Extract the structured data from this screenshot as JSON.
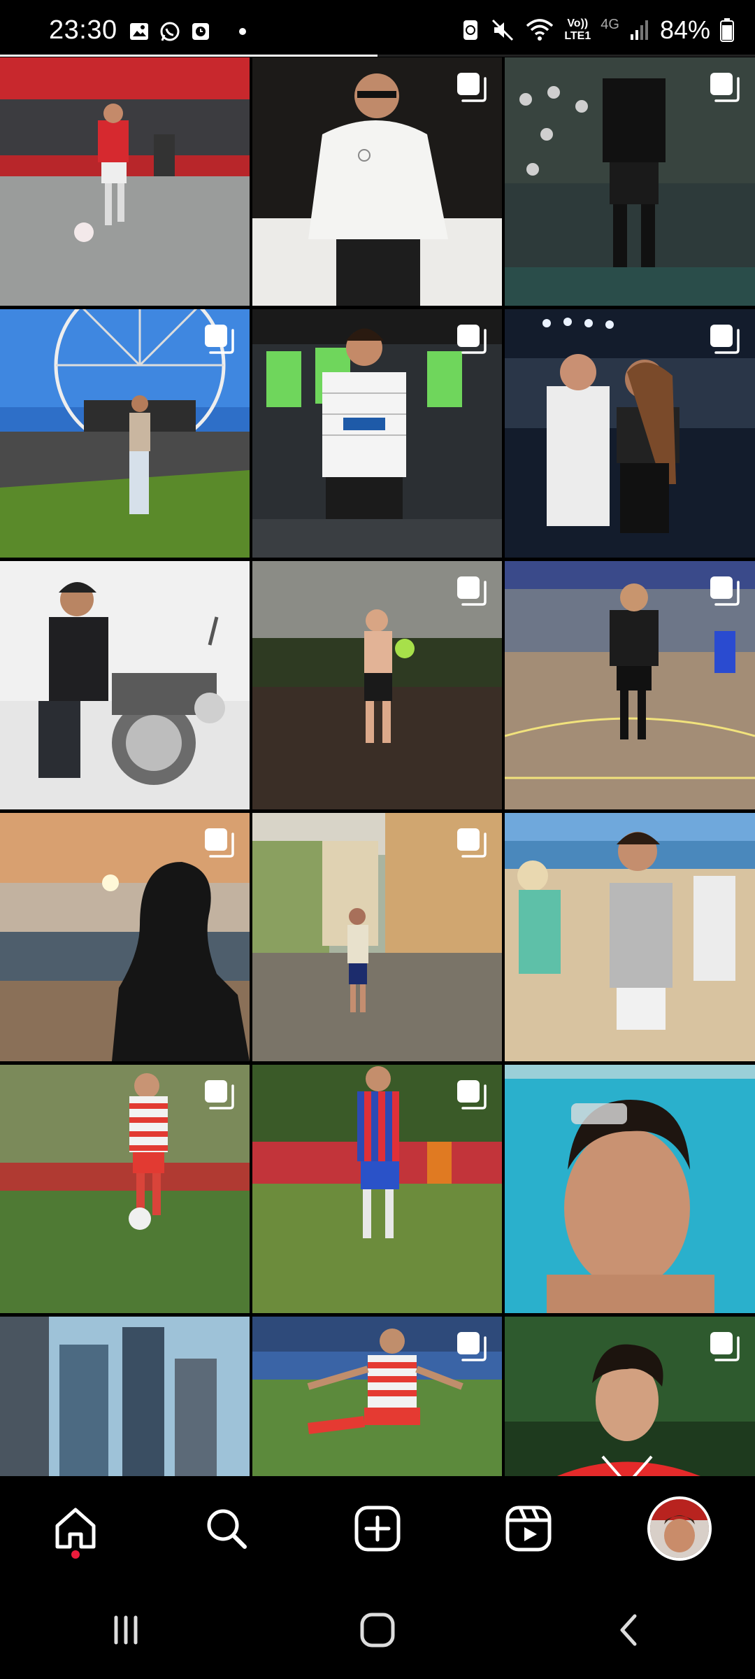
{
  "status_bar": {
    "time": "23:30",
    "left_icons": [
      "gallery-icon",
      "whatsapp-icon",
      "clock-app-icon",
      "notification-dot"
    ],
    "right_icons": [
      "recycle-icon",
      "mute-icon",
      "wifi-icon",
      "volte-icon",
      "4g-icon",
      "signal-icon",
      "battery-icon"
    ],
    "volte_label_top": "Vo))",
    "volte_label_bottom": "LTE1",
    "network_type": "4G",
    "battery": "84%",
    "battery_level": 0.84
  },
  "loading_progress": 0.5,
  "grid": {
    "posts": [
      {
        "label": "soccer-red-jersey",
        "multi": false
      },
      {
        "label": "white-hoodie",
        "multi": true
      },
      {
        "label": "futsal-crowd",
        "multi": true
      },
      {
        "label": "ferris-wheel",
        "multi": true
      },
      {
        "label": "piaget-jersey",
        "multi": true
      },
      {
        "label": "couple-concert",
        "multi": true
      },
      {
        "label": "motorcycle",
        "multi": false
      },
      {
        "label": "green-ball-night",
        "multi": true
      },
      {
        "label": "futsal-court",
        "multi": true
      },
      {
        "label": "sunset-silhouette",
        "multi": true
      },
      {
        "label": "colonial-street",
        "multi": true
      },
      {
        "label": "beach-crowd",
        "multi": false
      },
      {
        "label": "red-white-kit",
        "multi": true
      },
      {
        "label": "blue-red-kit",
        "multi": true
      },
      {
        "label": "pool-selfie",
        "multi": false
      },
      {
        "label": "city-skyline",
        "multi": false
      },
      {
        "label": "striped-kick",
        "multi": true
      },
      {
        "label": "red-shirt-portrait",
        "multi": true
      }
    ]
  },
  "bottom_nav": {
    "items": [
      "home-icon",
      "search-icon",
      "create-icon",
      "reels-icon",
      "profile-avatar"
    ],
    "active": "home",
    "notification_color": "#ed1c3c"
  },
  "system_nav": [
    "recents-icon",
    "home-square-icon",
    "back-icon"
  ]
}
